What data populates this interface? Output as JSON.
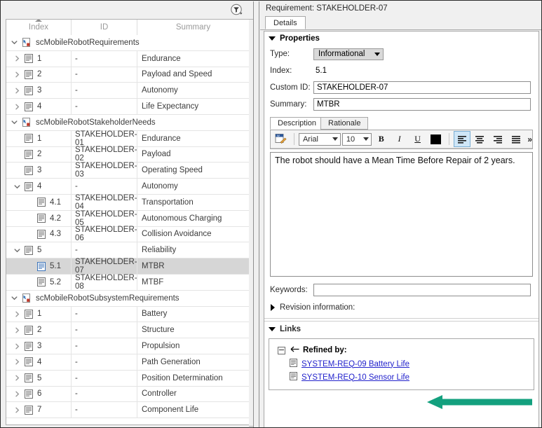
{
  "left_panel": {
    "toolbar": {
      "filter_icon": "filter-funnel-icon"
    },
    "columns": [
      {
        "label": "Index",
        "sorted": "ascending"
      },
      {
        "label": "ID"
      },
      {
        "label": "Summary"
      }
    ],
    "rows": [
      {
        "kind": "group",
        "depth": 0,
        "expanded": true,
        "icon": "requirement-set-icon",
        "label": "scMobileRobotRequirements"
      },
      {
        "kind": "item",
        "depth": 1,
        "expanded": false,
        "icon": "requirement-icon",
        "index": "1",
        "id": "-",
        "summary": "Endurance"
      },
      {
        "kind": "item",
        "depth": 1,
        "expanded": false,
        "icon": "requirement-icon",
        "index": "2",
        "id": "-",
        "summary": "Payload and Speed"
      },
      {
        "kind": "item",
        "depth": 1,
        "expanded": false,
        "icon": "requirement-icon",
        "index": "3",
        "id": "-",
        "summary": "Autonomy"
      },
      {
        "kind": "item",
        "depth": 1,
        "expanded": false,
        "icon": "requirement-icon",
        "index": "4",
        "id": "-",
        "summary": "Life Expectancy"
      },
      {
        "kind": "group",
        "depth": 0,
        "expanded": true,
        "icon": "requirement-set-icon",
        "label": "scMobileRobotStakeholderNeeds"
      },
      {
        "kind": "item",
        "depth": 1,
        "expanded": null,
        "icon": "requirement-icon",
        "index": "1",
        "id": "STAKEHOLDER-01",
        "summary": "Endurance"
      },
      {
        "kind": "item",
        "depth": 1,
        "expanded": null,
        "icon": "requirement-icon",
        "index": "2",
        "id": "STAKEHOLDER-02",
        "summary": "Payload"
      },
      {
        "kind": "item",
        "depth": 1,
        "expanded": null,
        "icon": "requirement-icon",
        "index": "3",
        "id": "STAKEHOLDER-03",
        "summary": "Operating Speed"
      },
      {
        "kind": "item",
        "depth": 1,
        "expanded": true,
        "icon": "requirement-icon",
        "index": "4",
        "id": "-",
        "summary": "Autonomy"
      },
      {
        "kind": "item",
        "depth": 2,
        "expanded": null,
        "icon": "requirement-icon",
        "index": "4.1",
        "id": "STAKEHOLDER-04",
        "summary": "Transportation"
      },
      {
        "kind": "item",
        "depth": 2,
        "expanded": null,
        "icon": "requirement-icon",
        "index": "4.2",
        "id": "STAKEHOLDER-05",
        "summary": "Autonomous Charging"
      },
      {
        "kind": "item",
        "depth": 2,
        "expanded": null,
        "icon": "requirement-icon",
        "index": "4.3",
        "id": "STAKEHOLDER-06",
        "summary": "Collision Avoidance"
      },
      {
        "kind": "item",
        "depth": 1,
        "expanded": true,
        "icon": "requirement-icon",
        "index": "5",
        "id": "-",
        "summary": "Reliability"
      },
      {
        "kind": "item",
        "depth": 2,
        "expanded": null,
        "icon": "requirement-icon",
        "index": "5.1",
        "id": "STAKEHOLDER-07",
        "summary": "MTBR",
        "selected": true
      },
      {
        "kind": "item",
        "depth": 2,
        "expanded": null,
        "icon": "requirement-icon",
        "index": "5.2",
        "id": "STAKEHOLDER-08",
        "summary": "MTBF"
      },
      {
        "kind": "group",
        "depth": 0,
        "expanded": true,
        "icon": "requirement-set-icon",
        "label": "scMobileRobotSubsystemRequirements"
      },
      {
        "kind": "item",
        "depth": 1,
        "expanded": false,
        "icon": "requirement-icon",
        "index": "1",
        "id": "-",
        "summary": "Battery"
      },
      {
        "kind": "item",
        "depth": 1,
        "expanded": false,
        "icon": "requirement-icon",
        "index": "2",
        "id": "-",
        "summary": "Structure"
      },
      {
        "kind": "item",
        "depth": 1,
        "expanded": false,
        "icon": "requirement-icon",
        "index": "3",
        "id": "-",
        "summary": "Propulsion"
      },
      {
        "kind": "item",
        "depth": 1,
        "expanded": false,
        "icon": "requirement-icon",
        "index": "4",
        "id": "-",
        "summary": "Path Generation"
      },
      {
        "kind": "item",
        "depth": 1,
        "expanded": false,
        "icon": "requirement-icon",
        "index": "5",
        "id": "-",
        "summary": "Position Determination"
      },
      {
        "kind": "item",
        "depth": 1,
        "expanded": false,
        "icon": "requirement-icon",
        "index": "6",
        "id": "-",
        "summary": "Controller"
      },
      {
        "kind": "item",
        "depth": 1,
        "expanded": false,
        "icon": "requirement-icon",
        "index": "7",
        "id": "-",
        "summary": "Component Life"
      }
    ]
  },
  "right_panel": {
    "title": "Requirement: STAKEHOLDER-07",
    "tab": "Details",
    "properties": {
      "section_label": "Properties",
      "expanded": true,
      "type_label": "Type:",
      "type_value": "Informational",
      "index_label": "Index:",
      "index_value": "5.1",
      "custom_id_label": "Custom ID:",
      "custom_id_value": "STAKEHOLDER-07",
      "summary_label": "Summary:",
      "summary_value": "MTBR"
    },
    "editor": {
      "tabs": [
        {
          "label": "Description",
          "active": true
        },
        {
          "label": "Rationale",
          "active": false
        }
      ],
      "toolbar": {
        "word_icon": "open-in-word-icon",
        "font_family": "Arial",
        "font_size": "10",
        "bold": "B",
        "italic": "I",
        "underline": "U",
        "text_color": "#000000",
        "align_left": "align-left-icon",
        "align_center": "align-center-icon",
        "align_right": "align-right-icon",
        "align_justify": "align-justify-icon",
        "overflow": "»",
        "active_alignment": "align-left"
      },
      "body_text": "The robot should have a Mean Time Before Repair of 2 years."
    },
    "keywords_label": "Keywords:",
    "keywords_value": "",
    "revision": {
      "label": "Revision information:",
      "expanded": false
    },
    "links": {
      "section_label": "Links",
      "expanded": true,
      "group_label": "Refined by:",
      "group_icon": "left-arrow-link-icon",
      "items": [
        {
          "icon": "requirement-icon",
          "label": "SYSTEM-REQ-09 Battery Life"
        },
        {
          "icon": "requirement-icon",
          "label": "SYSTEM-REQ-10 Sensor Life"
        }
      ]
    }
  },
  "annotation": {
    "arrow": {
      "name": "green-pointer-arrow",
      "color": "#13a07e",
      "points_to": "SYSTEM-REQ-09 Battery Life"
    }
  }
}
